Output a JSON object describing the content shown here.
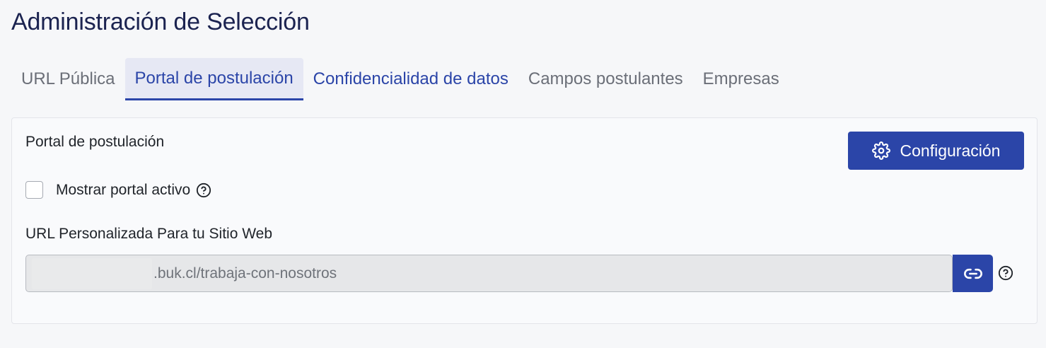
{
  "page": {
    "title": "Administración de Selección"
  },
  "tabs": [
    {
      "label": "URL Pública",
      "state": "inactive"
    },
    {
      "label": "Portal de postulación",
      "state": "active"
    },
    {
      "label": "Confidencialidad de datos",
      "state": "link"
    },
    {
      "label": "Campos postulantes",
      "state": "inactive"
    },
    {
      "label": "Empresas",
      "state": "inactive"
    }
  ],
  "card": {
    "title": "Portal de postulación",
    "config_button": {
      "label": "Configuración",
      "icon": "gear-icon"
    },
    "show_portal": {
      "label": "Mostrar portal activo",
      "checked": false,
      "help_icon": "question-circle-icon"
    },
    "url_section": {
      "label": "URL Personalizada Para tu Sitio Web",
      "url_suffix": ".buk.cl/trabaja-con-nosotros",
      "link_icon": "link-icon",
      "help_icon": "question-circle-icon"
    }
  },
  "colors": {
    "primary": "#2b45a8",
    "title": "#1b2350",
    "tab_inactive": "#6b6f78",
    "tab_active_bg": "#e6e8f4"
  }
}
